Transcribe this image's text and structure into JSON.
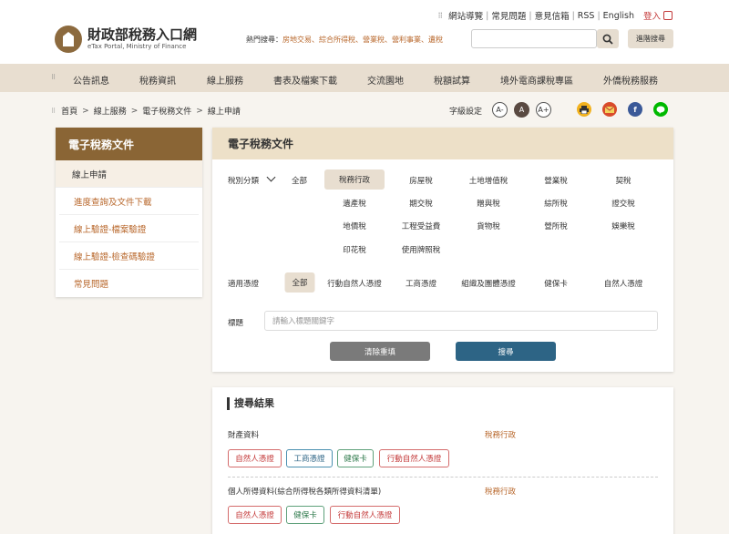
{
  "header": {
    "logo_title": "財政部稅務入口網",
    "logo_sub": "eTax Portal, Ministry of Finance",
    "top_links": [
      "網站導覽",
      "常見問題",
      "意見信箱",
      "RSS",
      "English"
    ],
    "login": "登入",
    "hot_label": "熱門搜尋：",
    "hot_links": "房地交易、綜合所得稅、營業稅、營利事業、遺稅",
    "advanced_search": "進階搜尋"
  },
  "nav": [
    "公告訊息",
    "稅務資訊",
    "線上服務",
    "書表及檔案下載",
    "交流園地",
    "稅額試算",
    "境外電商課稅專區",
    "外僑稅務服務"
  ],
  "breadcrumb": [
    "首頁",
    "線上服務",
    "電子稅務文件",
    "線上申請"
  ],
  "font_setting": {
    "label": "字級設定",
    "small": "A-",
    "medium": "A",
    "large": "A+"
  },
  "sidebar": {
    "title": "電子稅務文件",
    "items": [
      "線上申請",
      "進度查詢及文件下載",
      "線上驗證-檔案驗證",
      "線上驗證-檢查碼驗證",
      "常見問題"
    ]
  },
  "panel": {
    "title": "電子稅務文件",
    "category_label": "稅別分類",
    "category_all": "全部",
    "categories": [
      "稅務行政",
      "房屋稅",
      "土地增值稅",
      "營業稅",
      "契稅",
      "遺產稅",
      "期交稅",
      "贈與稅",
      "綜所稅",
      "證交稅",
      "地價稅",
      "工程受益費",
      "貨物稅",
      "營所稅",
      "娛樂稅",
      "印花稅",
      "使用牌照稅"
    ],
    "cred_label": "適用憑證",
    "creds": [
      "全部",
      "行動自然人憑證",
      "工商憑證",
      "組織及團體憑證",
      "健保卡",
      "自然人憑證"
    ],
    "keyword_label": "標題",
    "keyword_placeholder": "請輸入標題關鍵字",
    "clear_label": "清除重填",
    "search_label": "搜尋"
  },
  "results": {
    "title": "搜尋結果",
    "items": [
      {
        "name": "財產資料",
        "category": "稅務行政",
        "tags": [
          "自然人憑證",
          "工商憑證",
          "健保卡",
          "行動自然人憑證"
        ]
      },
      {
        "name": "個人所得資料(綜合所得稅各類所得資料清單)",
        "category": "稅務行政",
        "tags": [
          "自然人憑證",
          "健保卡",
          "行動自然人憑證"
        ]
      }
    ]
  },
  "colors": {
    "brand": "#8a6535",
    "accent": "#b8672b",
    "primary_button": "#2d6485"
  }
}
